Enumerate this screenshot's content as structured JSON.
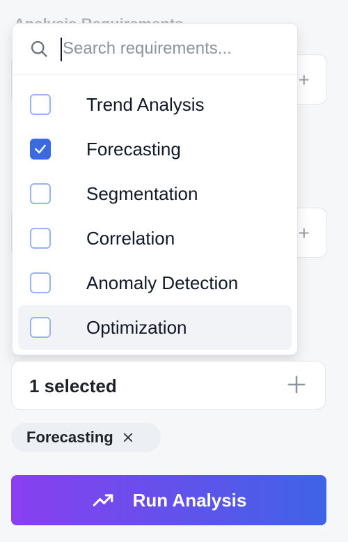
{
  "background": {
    "label_text": "Analysis Requirements"
  },
  "dropdown": {
    "search_placeholder": "Search requirements...",
    "options": [
      {
        "label": "Trend Analysis",
        "checked": false
      },
      {
        "label": "Forecasting",
        "checked": true
      },
      {
        "label": "Segmentation",
        "checked": false
      },
      {
        "label": "Correlation",
        "checked": false
      },
      {
        "label": "Anomaly Detection",
        "checked": false
      },
      {
        "label": "Optimization",
        "checked": false,
        "hover": true
      }
    ]
  },
  "selection": {
    "summary": "1 selected"
  },
  "chips": [
    {
      "label": "Forecasting"
    }
  ],
  "actions": {
    "run_label": "Run Analysis"
  },
  "colors": {
    "accent": "#3b6ae0",
    "gradient_start": "#8a3ff0",
    "gradient_end": "#3e63e6"
  },
  "icons": {
    "search": "search-icon",
    "check": "check-icon",
    "plus": "plus-icon",
    "close": "close-icon",
    "trend": "trending-up-icon"
  }
}
